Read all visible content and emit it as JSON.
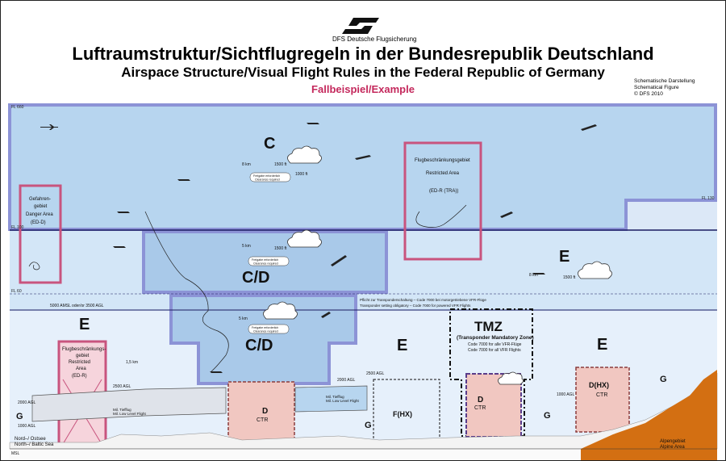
{
  "logo": {
    "org": "DFS Deutsche Flugsicherung"
  },
  "header": {
    "title_de": "Luftraumstruktur/Sichtflugregeln in der Bundesrepublik Deutschland",
    "title_en": "Airspace Structure/Visual Flight Rules in the Federal Republic of Germany",
    "subtitle": "Fallbeispiel/Example"
  },
  "side_note": {
    "line1": "Schematische Darstellung",
    "line2": "Schematical Figure",
    "line3": "© DFS 2010"
  },
  "levels": {
    "fl660": "FL 660",
    "fl100": "FL 100",
    "fl60": "FL 60",
    "fl130": "FL 130"
  },
  "airspace": {
    "c": "C",
    "cd_upper": "C/D",
    "cd_lower": "C/D",
    "e_left": "E",
    "e_mid": "E",
    "e_right": "E",
    "e_far": "E",
    "g_left": "G",
    "g_mid": "G",
    "g_right": "G",
    "g_far": "G",
    "fhx": "F(HX)",
    "dhx": "D(HX)",
    "ctr": "CTR",
    "d": "D"
  },
  "zones": {
    "danger": {
      "line1": "Gefahren-",
      "line2": "gebiet",
      "line3": "Danger Area",
      "line4": "(ED-D)"
    },
    "restricted_upper": {
      "line1": "Flugbeschränkungsgebiet",
      "line2": "Restricted  Area",
      "line3": "(ED-R  (TRA))"
    },
    "restricted_lower": {
      "line1": "Flugbeschränkungs-",
      "line2": "gebiet",
      "line3": "Restricted",
      "line4": "Area",
      "line5": "(ED-R)"
    },
    "tmz": {
      "title": "TMZ",
      "subtitle": "(Transponder Mandatory Zone)",
      "line1": "Code 7000 for alle VFR-Flüge",
      "line2": "Code 7000 for all VFR Flights"
    }
  },
  "labels": {
    "amsl_line": "5000 AMSL oder/or 3500 AGL",
    "transponder_de": "Pflicht zur Transponderschaltung – Code 7000 bei motorgetriebene VFR-Flüge",
    "transponder_en": "Transponder setting obligatory – Code 7000 for powered VFR Flights",
    "vis_8km": "8 km",
    "vis_5km": "5 km",
    "vis_15km": "1,5 km",
    "ft_1500": "1500 ft",
    "ft_1000": "1000 ft",
    "clear_clouds": "Freigabe erforderlich",
    "clearance": "Clearance required",
    "agl_2500": "2500 AGL",
    "agl_2000": "2000 AGL",
    "agl_1000": "1000 AGL",
    "north_sea": "Nord–/ Ostsee",
    "north_baltic": "North–/ Baltic Sea",
    "msl": "MSL",
    "alps_de": "Alpengebiet",
    "alps_en": "Alpine Area",
    "low_flight_de": "Mil. Tiefflug",
    "low_flight_en": "Mil. Low Level Flight"
  },
  "colors": {
    "sky_light": "#d3e6f7",
    "c_fill": "#b7d5ef",
    "border_blue": "#8c93d6",
    "restricted": "#c8547e",
    "ctr_fill": "#f1c7c1",
    "terrain": "#d36f12",
    "title_red": "#c4285c"
  },
  "aircraft_icons": "airplane-icon",
  "cloud_icons": "cloud-icon"
}
